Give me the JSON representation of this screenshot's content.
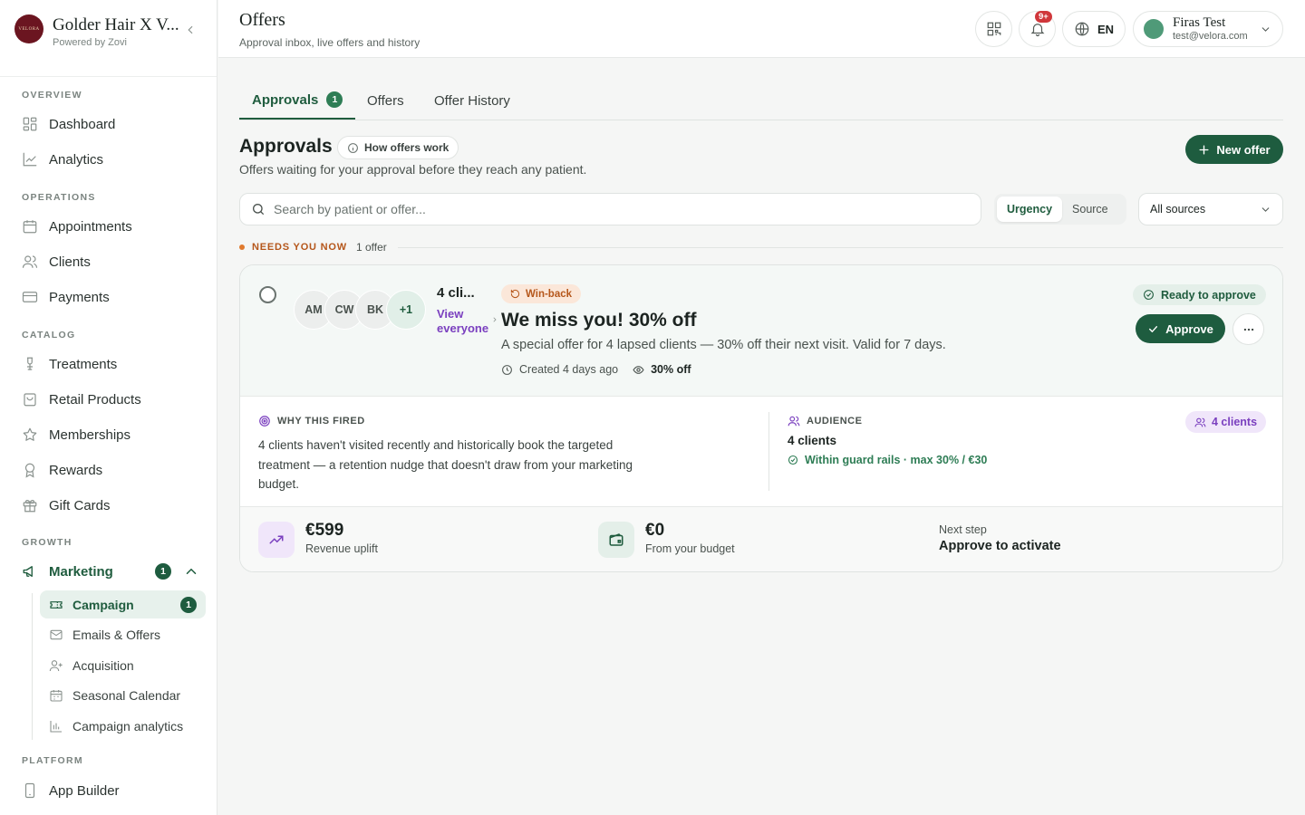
{
  "brand": {
    "logo_text": "VELORA",
    "name": "Golder Hair X V...",
    "powered_by": "Powered by Zovi"
  },
  "sidebar": {
    "sections": {
      "overview": "OVERVIEW",
      "operations": "OPERATIONS",
      "catalog": "CATALOG",
      "growth": "GROWTH",
      "platform": "PLATFORM"
    },
    "items": {
      "dashboard": "Dashboard",
      "analytics": "Analytics",
      "appointments": "Appointments",
      "clients": "Clients",
      "payments": "Payments",
      "treatments": "Treatments",
      "retail_products": "Retail Products",
      "memberships": "Memberships",
      "rewards": "Rewards",
      "gift_cards": "Gift Cards",
      "marketing": "Marketing",
      "marketing_badge": "1",
      "app_builder": "App Builder"
    },
    "marketing_sub": {
      "campaign": "Campaign",
      "campaign_badge": "1",
      "emails_offers": "Emails & Offers",
      "acquisition": "Acquisition",
      "seasonal_calendar": "Seasonal Calendar",
      "campaign_analytics": "Campaign analytics"
    }
  },
  "header": {
    "title": "Offers",
    "subtitle": "Approval inbox, live offers and history",
    "notifications_badge": "9+",
    "language": "EN",
    "user_name": "Firas Test",
    "user_email": "test@velora.com"
  },
  "tabs": {
    "approvals": "Approvals",
    "approvals_badge": "1",
    "offers": "Offers",
    "offer_history": "Offer History"
  },
  "approvals": {
    "title": "Approvals",
    "how_button": "How offers work",
    "subtitle": "Offers waiting for your approval before they reach any patient.",
    "new_offer_button": "New offer",
    "search_placeholder": "Search by patient or offer...",
    "filter_urgency": "Urgency",
    "filter_source": "Source",
    "source_select": "All sources",
    "urgency_label": "NEEDS YOU NOW",
    "urgency_count": "1 offer"
  },
  "offer_card": {
    "avatars": [
      "AM",
      "CW",
      "BK",
      "+1"
    ],
    "audience_title": "4 cli...",
    "view_everyone_1": "View",
    "view_everyone_2": "everyone",
    "tag": "Win-back",
    "title": "We miss you! 30% off",
    "description": "A special offer for 4 lapsed clients — 30% off their next visit. Valid for 7 days.",
    "created": "Created 4 days ago",
    "discount": "30% off",
    "status": "Ready to approve",
    "approve_button": "Approve",
    "why_label": "WHY THIS FIRED",
    "why_text": "4 clients haven't visited recently and historically book the targeted treatment — a retention nudge that doesn't draw from your marketing budget.",
    "audience_label": "AUDIENCE",
    "audience_count": "4 clients",
    "guard_rails": "Within guard rails · max 30% / €30",
    "clients_pill": "4 clients",
    "revenue_value": "€599",
    "revenue_label": "Revenue uplift",
    "budget_value": "€0",
    "budget_label": "From your budget",
    "next_step_label": "Next step",
    "next_step_value": "Approve to activate"
  },
  "colors": {
    "primary": "#1e5c3f",
    "accent_purple": "#7a3fbf",
    "urgency_orange": "#b5561a",
    "notification_red": "#d0373b"
  }
}
